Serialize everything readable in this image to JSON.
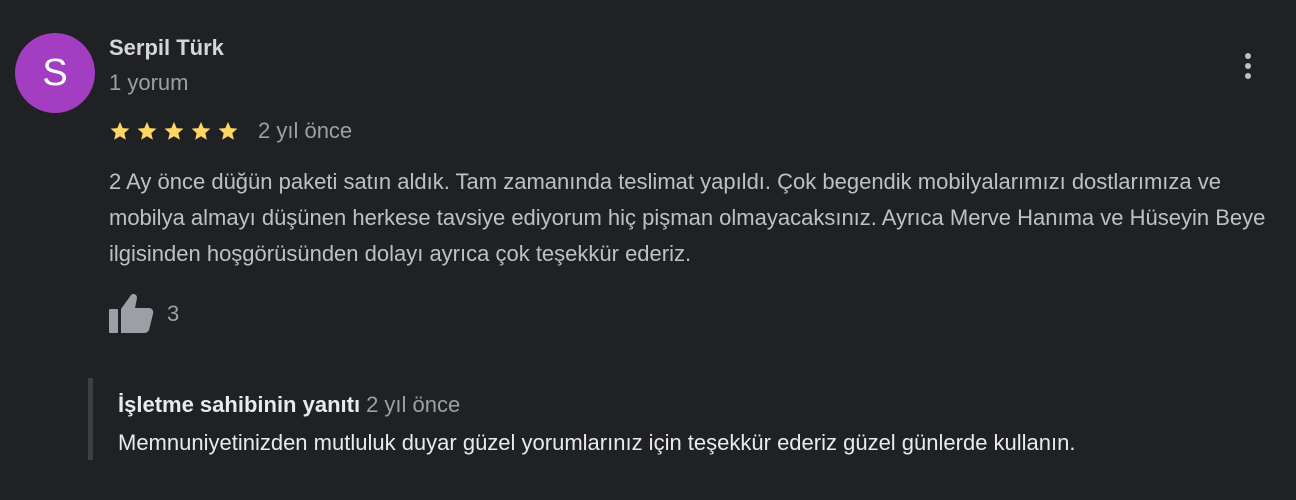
{
  "review": {
    "avatar_letter": "S",
    "avatar_color": "#a33dc1",
    "author_name": "Serpil Türk",
    "author_meta": "1 yorum",
    "rating": 5,
    "rating_max": 5,
    "star_color": "#fdd663",
    "time": "2 yıl önce",
    "text": "2 Ay önce düğün paketi satın aldık. Tam zamanında teslimat yapıldı. Çok begendik mobilyalarımızı dostlarımıza ve mobilya almayı düşünen herkese tavsiye ediyorum hiç pişman olmayacaksınız. Ayrıca Merve Hanıma ve Hüseyin Beye ilgisinden hoşgörüsünden dolayı ayrıca çok teşekkür ederiz.",
    "like_icon": "thumbs-up-icon",
    "like_count": "3",
    "menu_icon": "more-vert-icon"
  },
  "reply": {
    "owner_label": "İşletme sahibinin yanıtı",
    "time": "2 yıl önce",
    "text": "Memnuniyetinizden mutluluk duyar güzel yorumlarınız için teşekkür ederiz güzel günlerde kullanın."
  },
  "colors": {
    "background": "#202124",
    "primary_text": "#bdc1c6",
    "secondary_text": "#9aa0a6",
    "reply_bar": "#3c4043"
  }
}
